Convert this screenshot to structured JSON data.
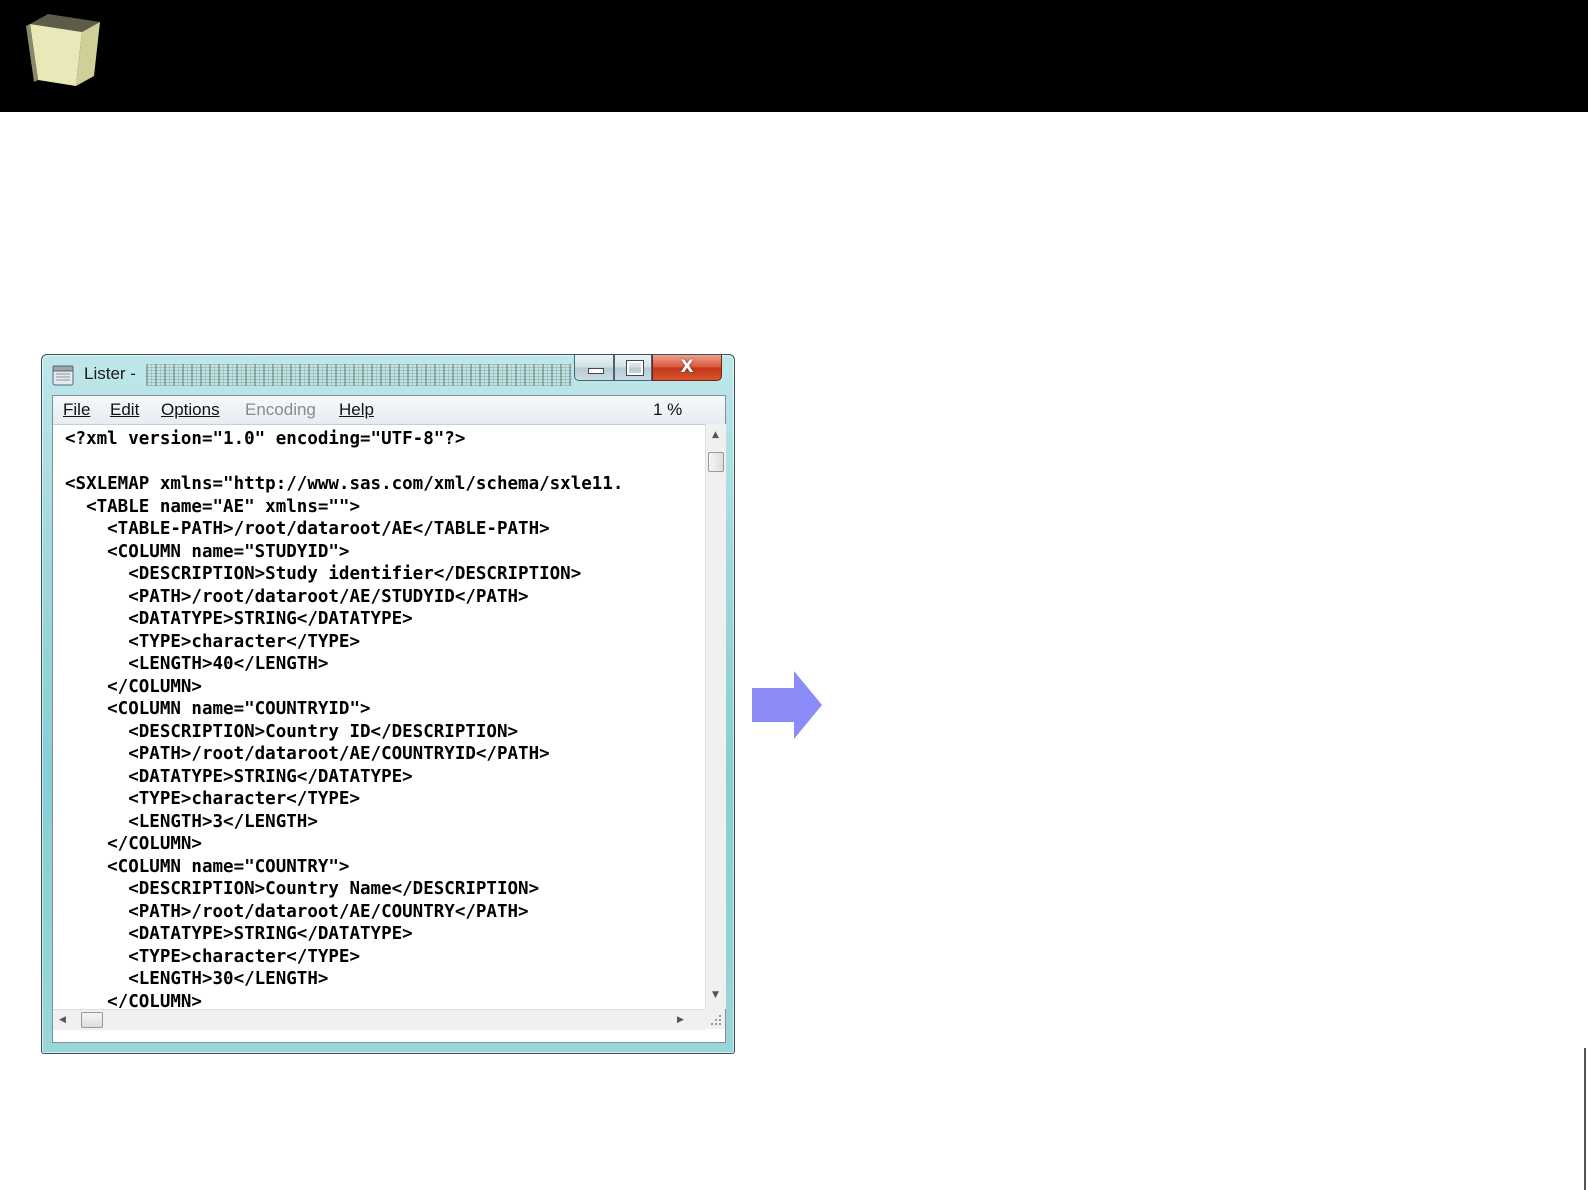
{
  "window": {
    "title": "Lister -",
    "controls": {
      "close_glyph": "X"
    }
  },
  "menu": {
    "items": [
      {
        "label": "File",
        "enabled": true
      },
      {
        "label": "Edit",
        "enabled": true
      },
      {
        "label": "Options",
        "enabled": true
      },
      {
        "label": "Encoding",
        "enabled": false
      },
      {
        "label": "Help",
        "enabled": true
      }
    ],
    "percent": "1 %"
  },
  "code_lines": [
    "<?xml version=\"1.0\" encoding=\"UTF-8\"?>",
    "",
    "<SXLEMAP xmlns=\"http://www.sas.com/xml/schema/sxle11.",
    "  <TABLE name=\"AE\" xmlns=\"\">",
    "    <TABLE-PATH>/root/dataroot/AE</TABLE-PATH>",
    "    <COLUMN name=\"STUDYID\">",
    "      <DESCRIPTION>Study identifier</DESCRIPTION>",
    "      <PATH>/root/dataroot/AE/STUDYID</PATH>",
    "      <DATATYPE>STRING</DATATYPE>",
    "      <TYPE>character</TYPE>",
    "      <LENGTH>40</LENGTH>",
    "    </COLUMN>",
    "    <COLUMN name=\"COUNTRYID\">",
    "      <DESCRIPTION>Country ID</DESCRIPTION>",
    "      <PATH>/root/dataroot/AE/COUNTRYID</PATH>",
    "      <DATATYPE>STRING</DATATYPE>",
    "      <TYPE>character</TYPE>",
    "      <LENGTH>3</LENGTH>",
    "    </COLUMN>",
    "    <COLUMN name=\"COUNTRY\">",
    "      <DESCRIPTION>Country Name</DESCRIPTION>",
    "      <PATH>/root/dataroot/AE/COUNTRY</PATH>",
    "      <DATATYPE>STRING</DATATYPE>",
    "      <TYPE>character</TYPE>",
    "      <LENGTH>30</LENGTH>",
    "    </COLUMN>"
  ],
  "colors": {
    "header_bar": "#000000",
    "arrow": "#8c8cf8",
    "cube_face": "#e8e8b8"
  },
  "icons": {
    "logo": "cube-icon",
    "app": "lister-icon",
    "next": "right-arrow-icon"
  }
}
